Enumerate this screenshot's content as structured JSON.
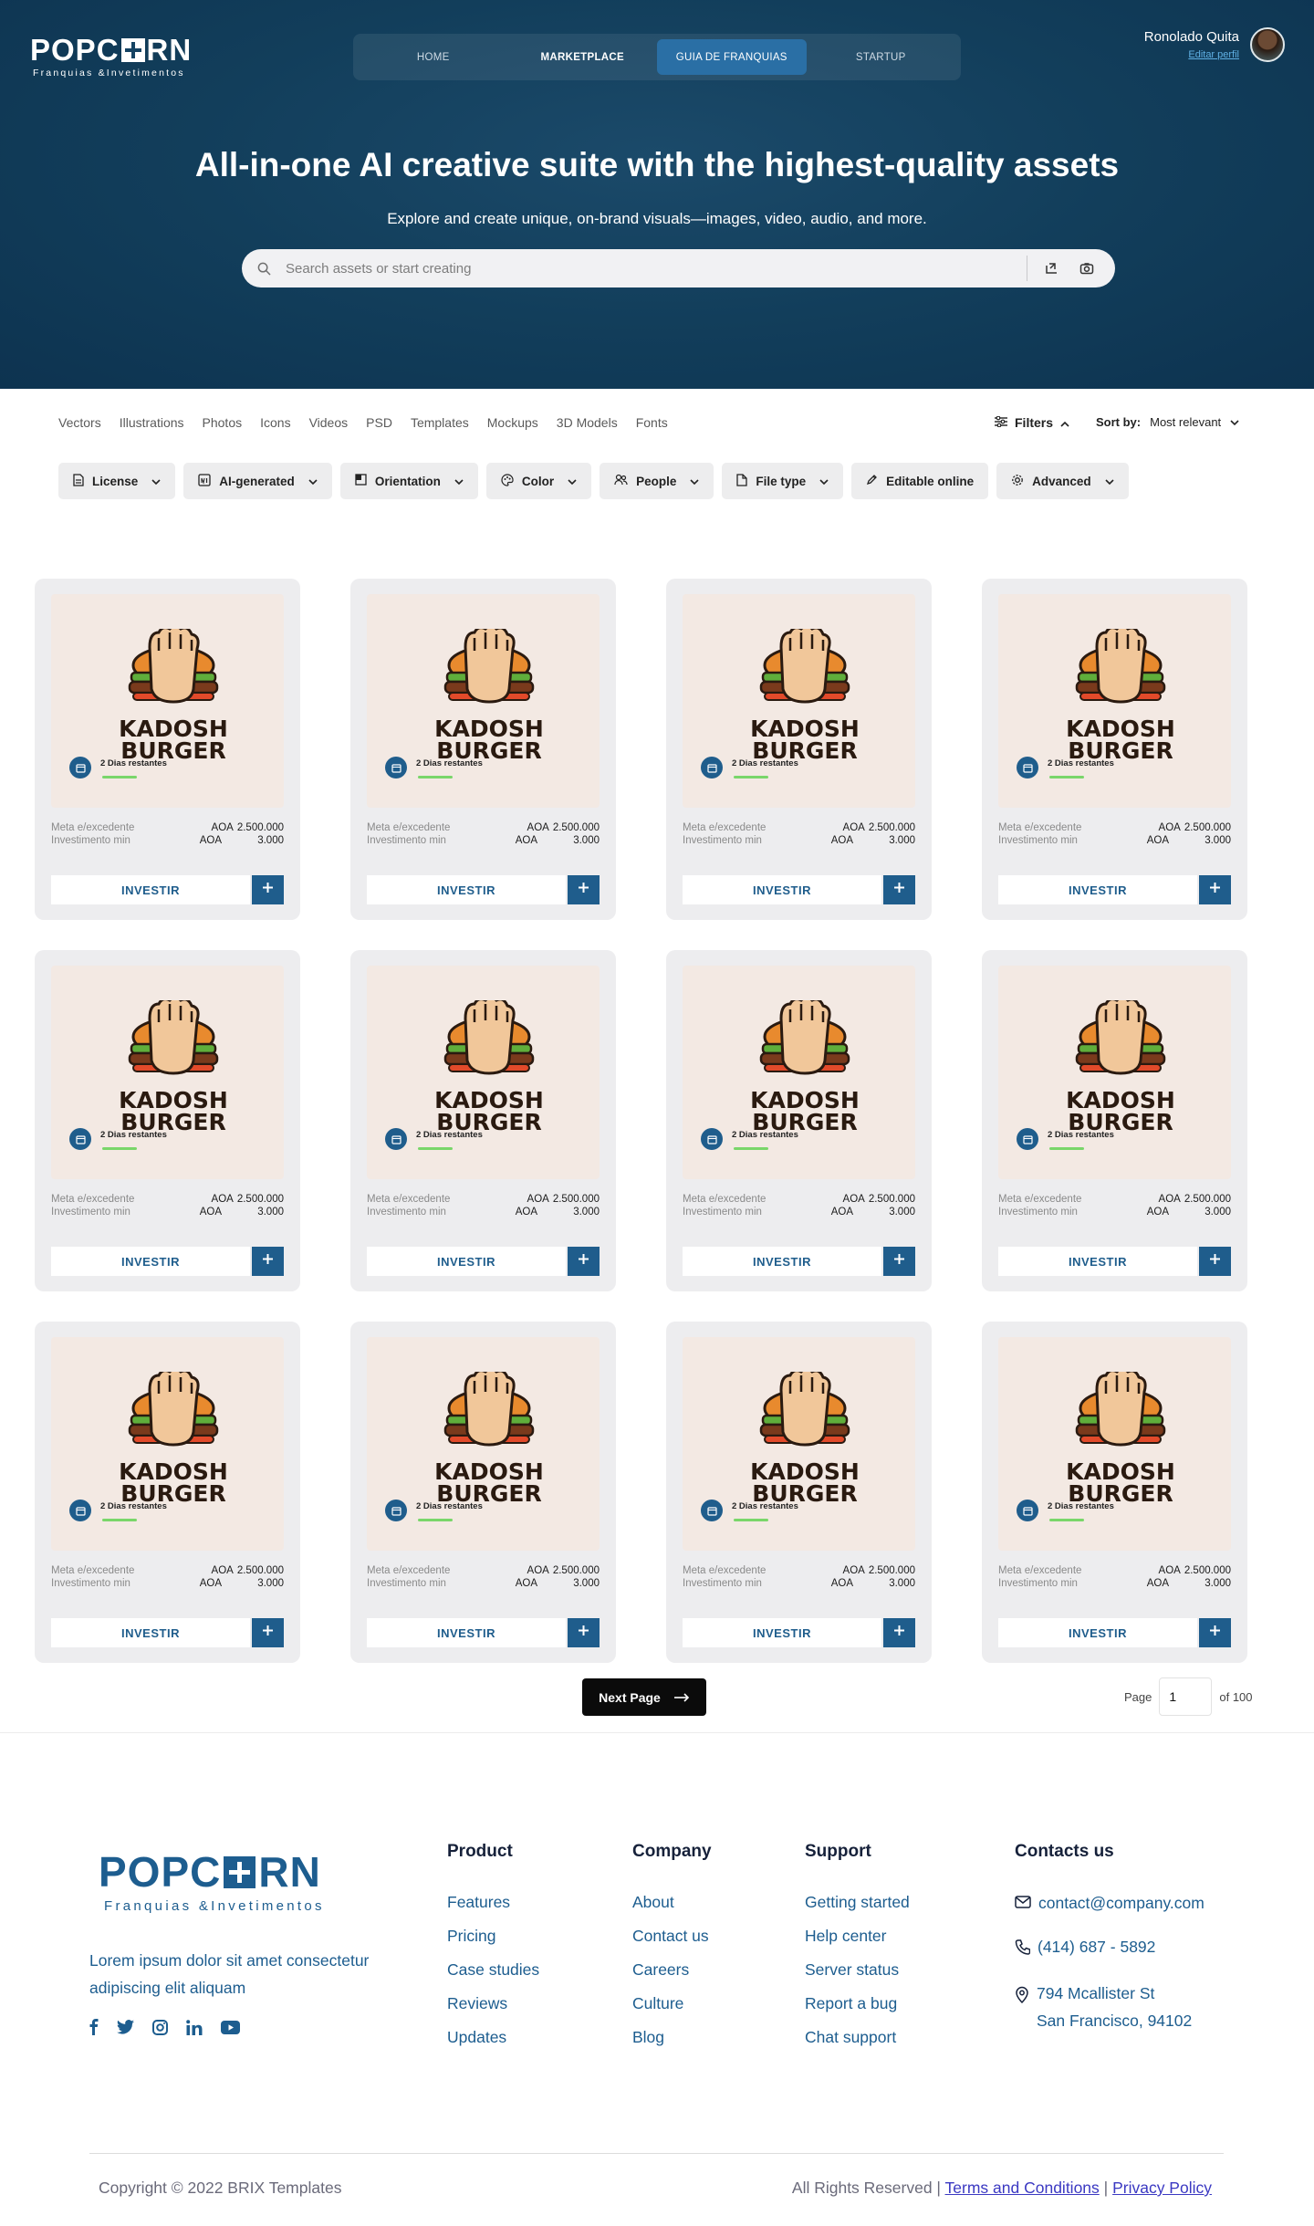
{
  "header": {
    "logo_word_left": "POPC",
    "logo_word_right": "RN",
    "logo_subtitle": "Franquias &Invetimentos",
    "nav": [
      {
        "label": "HOME"
      },
      {
        "label": "MARKETPLACE"
      },
      {
        "label": "GUIA DE FRANQUIAS"
      },
      {
        "label": "STARTUP"
      }
    ],
    "user_name": "Ronolado Quita",
    "edit_profile": "Editar perfil"
  },
  "hero": {
    "title": "All-in-one AI creative suite with the highest-quality assets",
    "tagline": "Explore and create unique, on-brand visuals—images, video, audio, and more.",
    "search_placeholder": "Search assets or start creating"
  },
  "categories": [
    "Vectors",
    "Illustrations",
    "Photos",
    "Icons",
    "Videos",
    "PSD",
    "Templates",
    "Mockups",
    "3D Models",
    "Fonts"
  ],
  "toolbar": {
    "filters_label": "Filters",
    "sort_label": "Sort by:",
    "sort_value": "Most relevant"
  },
  "chips": [
    {
      "label": "License",
      "icon": "document-icon",
      "dropdown": true
    },
    {
      "label": "AI-generated",
      "icon": "ai-icon",
      "dropdown": true
    },
    {
      "label": "Orientation",
      "icon": "orientation-icon",
      "dropdown": true
    },
    {
      "label": "Color",
      "icon": "palette-icon",
      "dropdown": true
    },
    {
      "label": "People",
      "icon": "people-icon",
      "dropdown": true
    },
    {
      "label": "File type",
      "icon": "file-icon",
      "dropdown": true
    },
    {
      "label": "Editable online",
      "icon": "pencil-icon",
      "dropdown": false
    },
    {
      "label": "Advanced",
      "icon": "gear-icon",
      "dropdown": true
    }
  ],
  "cards": [
    {
      "brand_line1": "KADOSH",
      "brand_line2": "BURGER",
      "days": "2 Dias restantes",
      "goal_label": "Meta e/excedente",
      "goal_currency": "AOA",
      "goal_value": "2.500.000",
      "min_label": "Investimento min",
      "min_currency": "AOA",
      "min_value": "3.000",
      "button": "INVESTIR"
    },
    {
      "brand_line1": "KADOSH",
      "brand_line2": "BURGER",
      "days": "2 Dias restantes",
      "goal_label": "Meta e/excedente",
      "goal_currency": "AOA",
      "goal_value": "2.500.000",
      "min_label": "Investimento min",
      "min_currency": "AOA",
      "min_value": "3.000",
      "button": "INVESTIR"
    },
    {
      "brand_line1": "KADOSH",
      "brand_line2": "BURGER",
      "days": "2 Dias restantes",
      "goal_label": "Meta e/excedente",
      "goal_currency": "AOA",
      "goal_value": "2.500.000",
      "min_label": "Investimento min",
      "min_currency": "AOA",
      "min_value": "3.000",
      "button": "INVESTIR"
    },
    {
      "brand_line1": "KADOSH",
      "brand_line2": "BURGER",
      "days": "2 Dias restantes",
      "goal_label": "Meta e/excedente",
      "goal_currency": "AOA",
      "goal_value": "2.500.000",
      "min_label": "Investimento min",
      "min_currency": "AOA",
      "min_value": "3.000",
      "button": "INVESTIR"
    },
    {
      "brand_line1": "KADOSH",
      "brand_line2": "BURGER",
      "days": "2 Dias restantes",
      "goal_label": "Meta e/excedente",
      "goal_currency": "AOA",
      "goal_value": "2.500.000",
      "min_label": "Investimento min",
      "min_currency": "AOA",
      "min_value": "3.000",
      "button": "INVESTIR"
    },
    {
      "brand_line1": "KADOSH",
      "brand_line2": "BURGER",
      "days": "2 Dias restantes",
      "goal_label": "Meta e/excedente",
      "goal_currency": "AOA",
      "goal_value": "2.500.000",
      "min_label": "Investimento min",
      "min_currency": "AOA",
      "min_value": "3.000",
      "button": "INVESTIR"
    },
    {
      "brand_line1": "KADOSH",
      "brand_line2": "BURGER",
      "days": "2 Dias restantes",
      "goal_label": "Meta e/excedente",
      "goal_currency": "AOA",
      "goal_value": "2.500.000",
      "min_label": "Investimento min",
      "min_currency": "AOA",
      "min_value": "3.000",
      "button": "INVESTIR"
    },
    {
      "brand_line1": "KADOSH",
      "brand_line2": "BURGER",
      "days": "2 Dias restantes",
      "goal_label": "Meta e/excedente",
      "goal_currency": "AOA",
      "goal_value": "2.500.000",
      "min_label": "Investimento min",
      "min_currency": "AOA",
      "min_value": "3.000",
      "button": "INVESTIR"
    },
    {
      "brand_line1": "KADOSH",
      "brand_line2": "BURGER",
      "days": "2 Dias restantes",
      "goal_label": "Meta e/excedente",
      "goal_currency": "AOA",
      "goal_value": "2.500.000",
      "min_label": "Investimento min",
      "min_currency": "AOA",
      "min_value": "3.000",
      "button": "INVESTIR"
    },
    {
      "brand_line1": "KADOSH",
      "brand_line2": "BURGER",
      "days": "2 Dias restantes",
      "goal_label": "Meta e/excedente",
      "goal_currency": "AOA",
      "goal_value": "2.500.000",
      "min_label": "Investimento min",
      "min_currency": "AOA",
      "min_value": "3.000",
      "button": "INVESTIR"
    },
    {
      "brand_line1": "KADOSH",
      "brand_line2": "BURGER",
      "days": "2 Dias restantes",
      "goal_label": "Meta e/excedente",
      "goal_currency": "AOA",
      "goal_value": "2.500.000",
      "min_label": "Investimento min",
      "min_currency": "AOA",
      "min_value": "3.000",
      "button": "INVESTIR"
    },
    {
      "brand_line1": "KADOSH",
      "brand_line2": "BURGER",
      "days": "2 Dias restantes",
      "goal_label": "Meta e/excedente",
      "goal_currency": "AOA",
      "goal_value": "2.500.000",
      "min_label": "Investimento min",
      "min_currency": "AOA",
      "min_value": "3.000",
      "button": "INVESTIR"
    }
  ],
  "pagination": {
    "next_label": "Next Page",
    "page_label": "Page",
    "current_page": "1",
    "of_label": "of 100"
  },
  "footer": {
    "logo_word_left": "POPC",
    "logo_word_right": "RN",
    "logo_subtitle": "Franquias &Invetimentos",
    "description": "Lorem ipsum dolor sit amet consectetur adipiscing elit aliquam",
    "socials": [
      "facebook-icon",
      "twitter-icon",
      "instagram-icon",
      "linkedin-icon",
      "youtube-icon"
    ],
    "columns": [
      {
        "title": "Product",
        "links": [
          "Features",
          "Pricing",
          "Case studies",
          "Reviews",
          "Updates"
        ]
      },
      {
        "title": "Company",
        "links": [
          "About",
          "Contact us",
          "Careers",
          "Culture",
          "Blog"
        ]
      },
      {
        "title": "Support",
        "links": [
          "Getting started",
          "Help center",
          "Server status",
          "Report a bug",
          "Chat support"
        ]
      }
    ],
    "contacts_title": "Contacts us",
    "email": "contact@company.com",
    "phone": "(414) 687 - 5892",
    "address_line1": "794 Mcallister St",
    "address_line2": "San Francisco, 94102",
    "copyright": "Copyright © 2022 BRIX Templates",
    "rights": "All Rights Reserved |",
    "terms": "Terms and Conditions",
    "divider": "|",
    "privacy": "Privacy Policy"
  },
  "colors": {
    "hero_bg": "#123e5b",
    "accent": "#1f5d8c",
    "nav_active": "#2a6fa5",
    "progress": "#79d66a",
    "card_bg": "#ededef"
  }
}
